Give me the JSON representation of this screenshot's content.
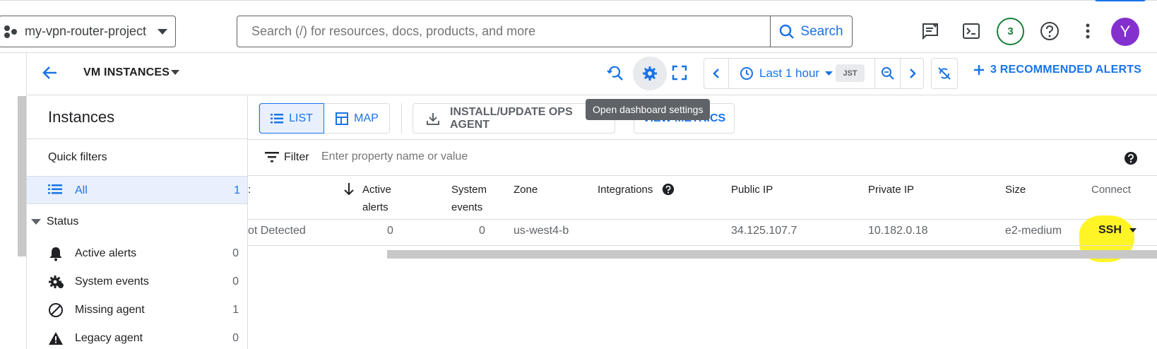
{
  "header": {
    "project": "my-vpn-router-project",
    "search": {
      "placeholder": "Search (/) for resources, docs, products, and more",
      "button": "Search"
    },
    "notifications_count": "3",
    "avatar_initial": "Y"
  },
  "toolbar": {
    "title": "VM INSTANCES",
    "time_range": "Last 1 hour",
    "timezone": "JST",
    "alerts_label": "3 RECOMMENDED ALERTS",
    "tooltip": "Open dashboard settings"
  },
  "sidebar": {
    "title": "Instances",
    "quick_filters": "Quick filters",
    "all": {
      "label": "All",
      "count": "1"
    },
    "status_label": "Status",
    "items": [
      {
        "label": "Active alerts",
        "count": "0",
        "icon": "bell-icon"
      },
      {
        "label": "System events",
        "count": "0",
        "icon": "gear-alert-icon"
      },
      {
        "label": "Missing agent",
        "count": "1",
        "icon": "block-icon"
      },
      {
        "label": "Legacy agent",
        "count": "0",
        "icon": "warning-icon"
      }
    ]
  },
  "content": {
    "view_list": "LIST",
    "view_map": "MAP",
    "install_btn": "INSTALL/UPDATE OPS AGENT",
    "metrics_btn": "VIEW METRICS",
    "filter_label": "Filter",
    "filter_placeholder": "Enter property name or value"
  },
  "table": {
    "headers": {
      "active_alerts_1": "Active",
      "active_alerts_2": "alerts",
      "system_events_1": "System",
      "system_events_2": "events",
      "zone": "Zone",
      "integrations": "Integrations",
      "public_ip": "Public IP",
      "private_ip": "Private IP",
      "size": "Size",
      "connect": "Connect"
    },
    "row": {
      "agent_status": "ot Detected",
      "active_alerts": "0",
      "system_events": "0",
      "zone": "us-west4-b",
      "public_ip": "34.125.107.7",
      "private_ip": "10.182.0.18",
      "size": "e2-medium",
      "connect": "SSH"
    }
  },
  "colors": {
    "accent": "#1a73e8",
    "avatar": "#8430ce",
    "badge": "#188038",
    "highlight": "#fff200"
  }
}
